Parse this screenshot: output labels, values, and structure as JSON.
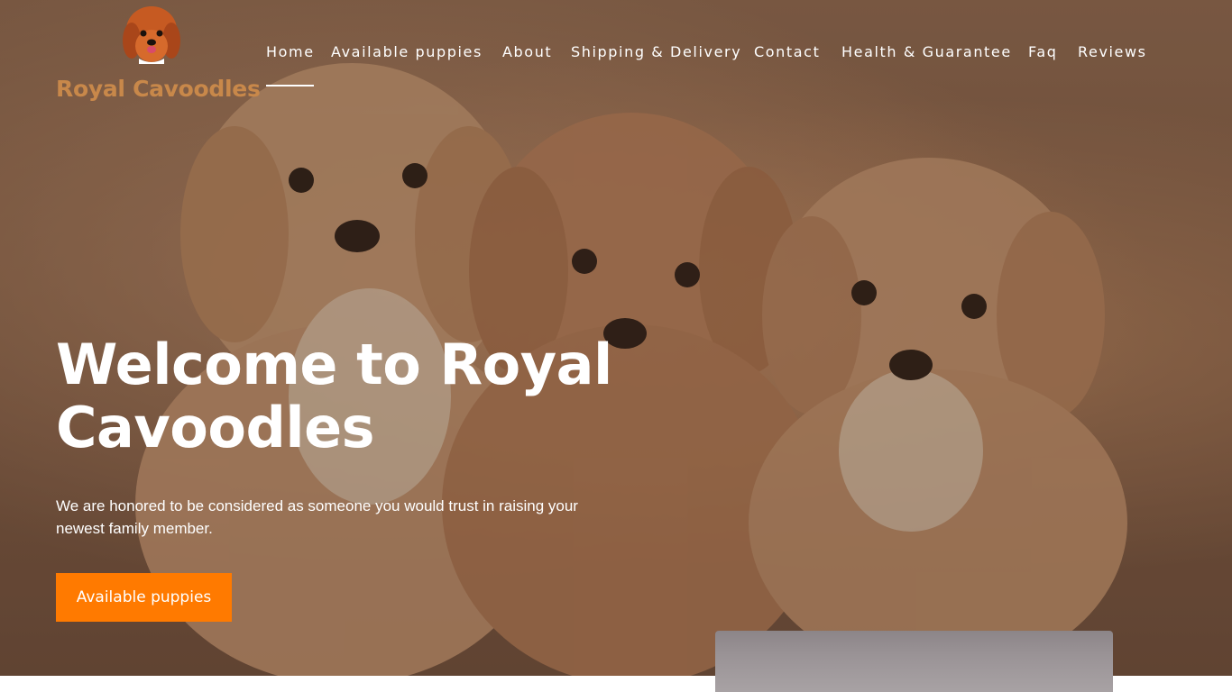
{
  "brand": {
    "name": "Royal Cavoodles",
    "logo_icon": "dog-face-logo"
  },
  "nav": {
    "items": [
      {
        "label": "Home",
        "active": true
      },
      {
        "label": "Available puppies"
      },
      {
        "label": "About"
      },
      {
        "label": "Shipping & Delivery"
      },
      {
        "label": "Contact"
      },
      {
        "label": "Health & Guarantee"
      },
      {
        "label": "Faq"
      },
      {
        "label": "Reviews"
      }
    ]
  },
  "hero": {
    "title_line1": "Welcome to Royal",
    "title_line2": "Cavoodles",
    "subtitle": "We are honored to be considered as someone you would trust in raising your newest family member.",
    "cta_label": "Available puppies"
  },
  "colors": {
    "accent": "#ff7a00",
    "brand_text": "#c8884a",
    "hero_bg": "#8f6a50"
  }
}
